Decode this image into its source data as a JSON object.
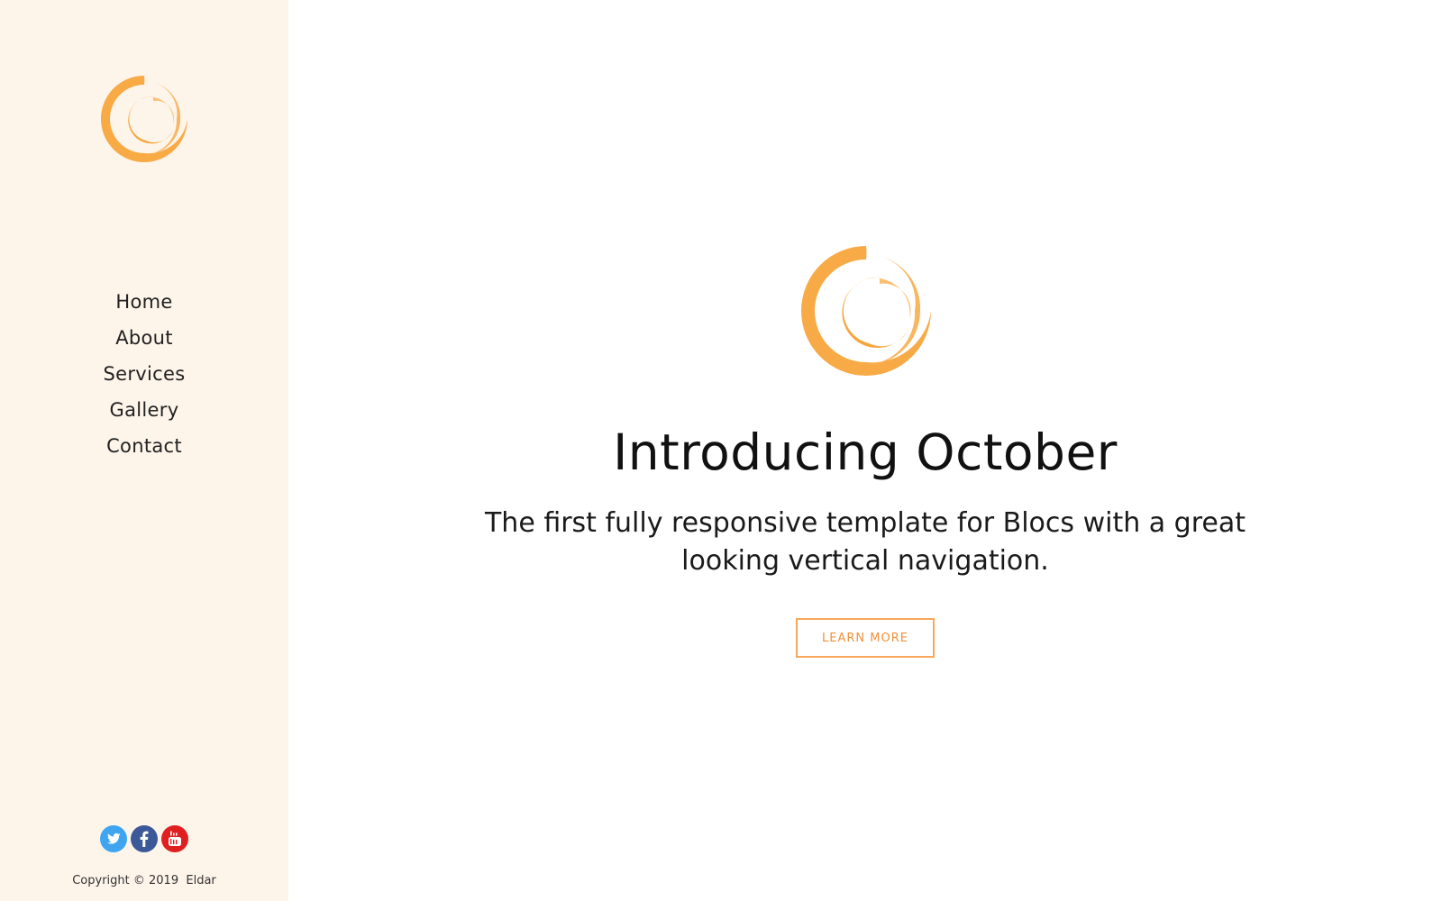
{
  "brand": {
    "logo_icon": "orange-swirl-logo",
    "accent_color": "#f8a53c"
  },
  "sidebar": {
    "nav_items": [
      {
        "label": "Home"
      },
      {
        "label": "About"
      },
      {
        "label": "Services"
      },
      {
        "label": "Gallery"
      },
      {
        "label": "Contact"
      }
    ],
    "social": [
      {
        "name": "twitter-icon",
        "color": "#3fa5f0"
      },
      {
        "name": "facebook-icon",
        "color": "#3b5998"
      },
      {
        "name": "youtube-icon",
        "color": "#e02020"
      }
    ],
    "copyright": "Copyright © 2019  Eldar"
  },
  "hero": {
    "title": "Introducing October",
    "subtitle": "The first fully responsive template for Blocs with a great looking vertical navigation.",
    "button_label": "LEARN MORE",
    "button_color": "#f8a85a"
  }
}
